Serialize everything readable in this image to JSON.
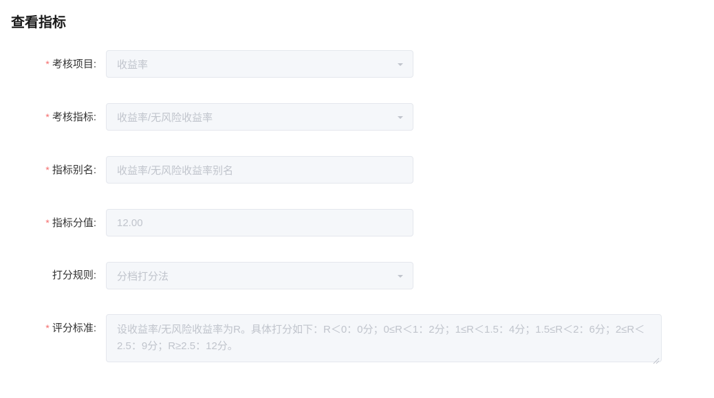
{
  "page": {
    "title": "查看指标"
  },
  "form": {
    "fields": {
      "assessmentProject": {
        "label": "考核项目:",
        "value": "收益率",
        "required": true,
        "type": "select"
      },
      "assessmentIndicator": {
        "label": "考核指标:",
        "value": "收益率/无风险收益率",
        "required": true,
        "type": "select"
      },
      "indicatorAlias": {
        "label": "指标别名:",
        "value": "收益率/无风险收益率别名",
        "required": true,
        "type": "input"
      },
      "indicatorScore": {
        "label": "指标分值:",
        "value": "12.00",
        "required": true,
        "type": "input"
      },
      "scoringRule": {
        "label": "打分规则:",
        "value": "分档打分法",
        "required": false,
        "type": "select"
      },
      "scoringStandard": {
        "label": "评分标准:",
        "value": "设收益率/无风险收益率为R。具体打分如下：R＜0：0分；0≤R＜1：2分；1≤R＜1.5：4分；1.5≤R＜2：6分；2≤R＜2.5：9分；R≥2.5：12分。",
        "required": true,
        "type": "textarea"
      }
    }
  }
}
